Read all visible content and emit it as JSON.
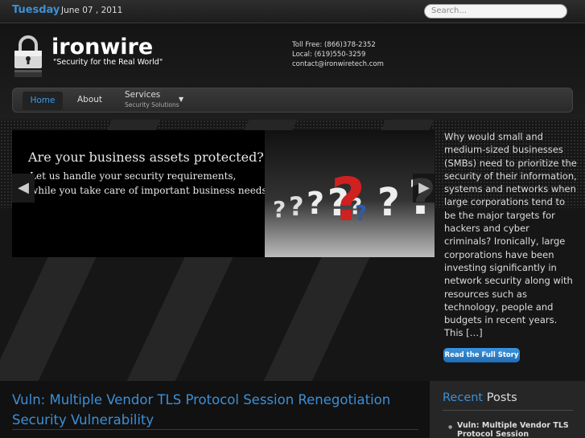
{
  "topbar": {
    "day": "Tuesday",
    "date": "June 07 , 2011",
    "search_placeholder": "Search..."
  },
  "header": {
    "logo": "ironwire",
    "tagline": "\"Security for the Real World\"",
    "contact": {
      "toll_free": "Toll Free: (866)378-2352",
      "local": "Local: (619)550-3259",
      "email": "contact@ironwiretech.com"
    }
  },
  "nav": {
    "home": "Home",
    "about": "About",
    "services": "Services",
    "services_sub": "Security Solutions"
  },
  "slider": {
    "heading": "Are your business assets protected?",
    "line1": "Let us handle your security requirements,",
    "line2": "while you take care of important business needs"
  },
  "story": {
    "text": "Why would small and medium-sized businesses (SMBs) need to prioritize the security of their information, systems and networks when large corporations tend to be the major targets for hackers and cyber criminals? Ironically, large corporations have been investing significantly in network security along with resources such as technology, people and budgets in recent years. This […]",
    "button": "Read the Full Story"
  },
  "post": {
    "title": "Vuln: Multiple Vendor TLS Protocol Session Renegotiation Security Vulnerability"
  },
  "sidebar": {
    "recent_1": "Recent",
    "recent_2": "Posts",
    "item": "Vuln: Multiple Vendor TLS Protocol Session"
  },
  "colors": {
    "accent": "#3d8fd6",
    "button": "#2a80cc",
    "background": "#111111"
  }
}
